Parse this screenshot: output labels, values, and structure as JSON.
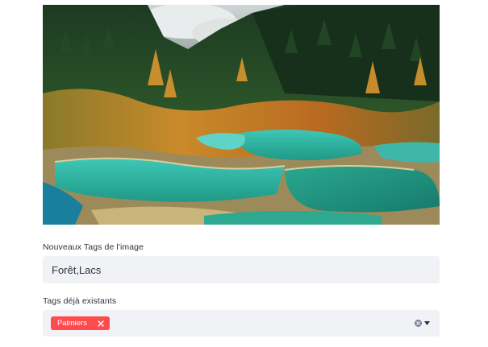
{
  "image": {
    "description_icon": "landscape-image"
  },
  "new_tags": {
    "label": "Nouveaux Tags de l'image",
    "value": "Forêt,Lacs"
  },
  "existing_tags": {
    "label": "Tags déjà existants",
    "selected": [
      "Palmiers"
    ]
  },
  "colors": {
    "tag_background": "#ff4b4b",
    "input_background": "#f0f2f6",
    "text": "#31333f"
  }
}
